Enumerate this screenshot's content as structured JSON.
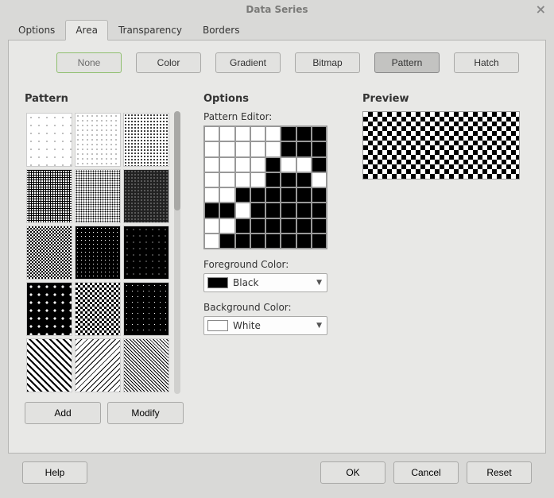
{
  "title": "Data Series",
  "tabs": {
    "options": "Options",
    "area": "Area",
    "transparency": "Transparency",
    "borders": "Borders",
    "active": "Area"
  },
  "fill_buttons": {
    "none": "None",
    "color": "Color",
    "gradient": "Gradient",
    "bitmap": "Bitmap",
    "pattern": "Pattern",
    "hatch": "Hatch",
    "pressed": "Pattern",
    "highlighted": "None"
  },
  "sections": {
    "pattern": "Pattern",
    "options": "Options",
    "preview": "Preview"
  },
  "pattern_panel": {
    "add": "Add",
    "modify": "Modify"
  },
  "options_panel": {
    "editor_label": "Pattern Editor:",
    "fg_label": "Foreground Color:",
    "fg_value": "Black",
    "fg_hex": "#000000",
    "bg_label": "Background Color:",
    "bg_value": "White",
    "bg_hex": "#ffffff",
    "grid": [
      [
        0,
        0,
        0,
        0,
        0,
        1,
        1,
        1
      ],
      [
        0,
        0,
        0,
        0,
        0,
        1,
        1,
        1
      ],
      [
        0,
        0,
        0,
        0,
        1,
        0,
        0,
        1
      ],
      [
        0,
        0,
        0,
        0,
        1,
        1,
        1,
        0
      ],
      [
        0,
        0,
        1,
        1,
        1,
        1,
        1,
        1
      ],
      [
        1,
        1,
        0,
        1,
        1,
        1,
        1,
        1
      ],
      [
        0,
        0,
        1,
        1,
        1,
        1,
        1,
        1
      ],
      [
        0,
        1,
        1,
        1,
        1,
        1,
        1,
        1
      ]
    ]
  },
  "footer": {
    "help": "Help",
    "ok": "OK",
    "cancel": "Cancel",
    "reset": "Reset"
  }
}
